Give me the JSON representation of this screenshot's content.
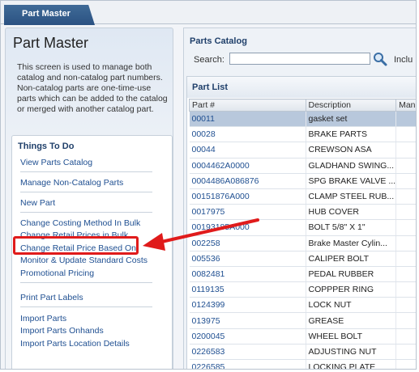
{
  "tab": {
    "label": "Part Master"
  },
  "left_panel": {
    "title": "Part Master",
    "description": "This screen is used to manage both catalog and non-catalog part numbers. Non-catalog parts are one-time-use parts which can be added to the catalog or merged with another catalog part."
  },
  "todo": {
    "title": "Things To Do",
    "links": [
      "View Parts Catalog",
      "Manage Non-Catalog Parts",
      "New Part",
      "Change Costing Method In Bulk",
      "Change Retail Prices in Bulk",
      "Change Retail Price Based On",
      "Monitor & Update Standard Costs",
      "Promotional Pricing",
      "Print Part Labels",
      "Import Parts",
      "Import Parts Onhands",
      "Import Parts Location Details"
    ]
  },
  "catalog": {
    "title": "Parts Catalog",
    "search_label": "Search:",
    "search_value": "",
    "include_label": "Inclu"
  },
  "part_list": {
    "title": "Part List",
    "columns": [
      "Part #",
      "Description",
      "Manu"
    ],
    "rows": [
      [
        "00011",
        "gasket set",
        ""
      ],
      [
        "00028",
        "BRAKE PARTS",
        ""
      ],
      [
        "00044",
        "CREWSON ASA",
        ""
      ],
      [
        "0004462A0000",
        "GLADHAND SWING...",
        ""
      ],
      [
        "0004486A086876",
        "SPG BRAKE VALVE ...",
        ""
      ],
      [
        "00151876A000",
        "CLAMP STEEL RUB...",
        ""
      ],
      [
        "0017975",
        "HUB COVER",
        ""
      ],
      [
        "00193185A000",
        "BOLT 5/8\" X 1\"",
        ""
      ],
      [
        "002258",
        "Brake Master Cylin...",
        ""
      ],
      [
        "005536",
        "CALIPER BOLT",
        ""
      ],
      [
        "0082481",
        "PEDAL RUBBER",
        ""
      ],
      [
        "0119135",
        "COPPPER RING",
        ""
      ],
      [
        "0124399",
        "LOCK NUT",
        ""
      ],
      [
        "013975",
        "GREASE",
        ""
      ],
      [
        "0200045",
        "WHEEL BOLT",
        ""
      ],
      [
        "0226583",
        "ADJUSTING NUT",
        ""
      ],
      [
        "0226585",
        "LOCKING PLATE",
        ""
      ]
    ],
    "selected_row": 0
  },
  "colors": {
    "tab": "#2b5282",
    "link": "#1f4f91",
    "selected_row": "#b8c8dc",
    "annotation": "#e01b1b"
  }
}
